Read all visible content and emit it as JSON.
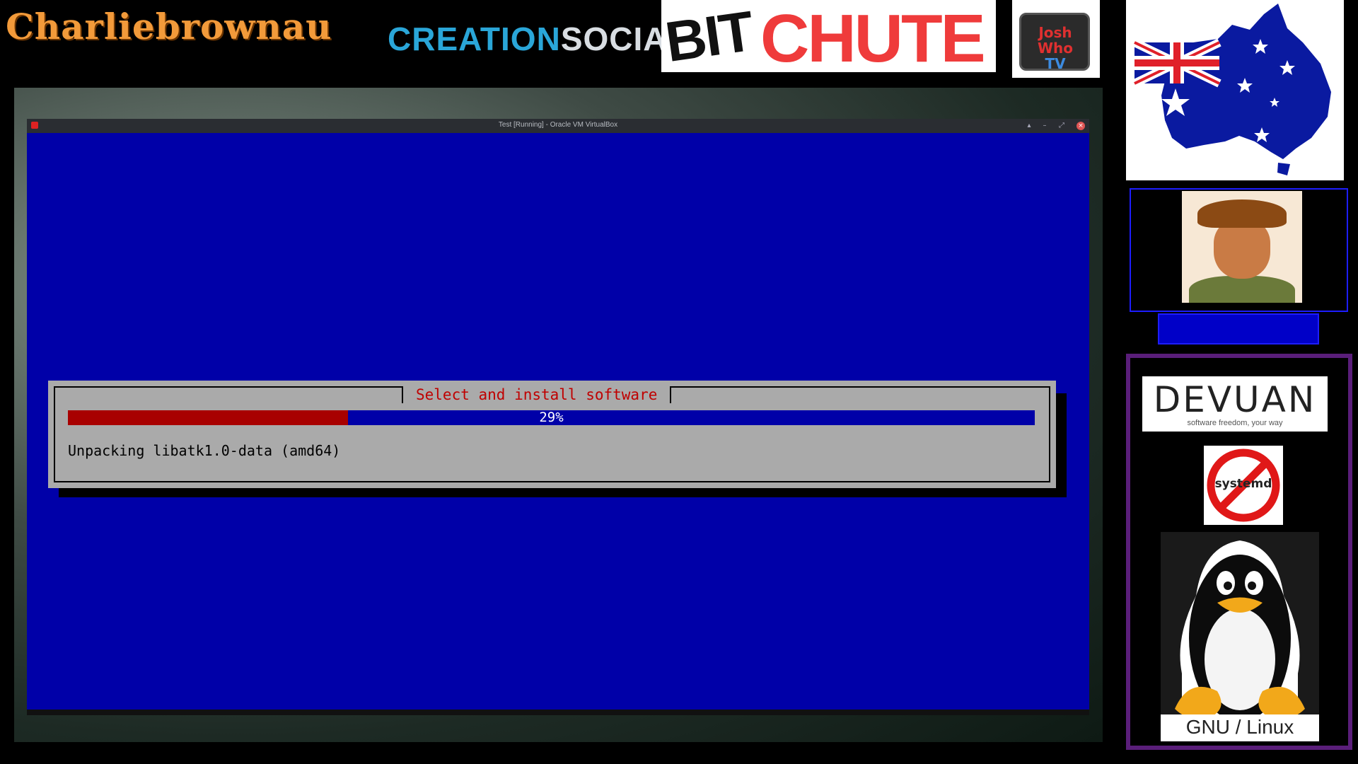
{
  "header": {
    "channel_name": "Charliebrownau",
    "creation_social_part1": "CREATION",
    "creation_social_part2": "SOCIAL",
    "bitchute_part1": "BIT",
    "bitchute_part2": "CHUTE",
    "joshwho_line1": "Josh Who",
    "joshwho_line2": "TV"
  },
  "vm": {
    "window_title": "Test [Running] - Oracle VM VirtualBox",
    "installer": {
      "dialog_title": "Select and install software",
      "progress_percent": 29,
      "progress_label": "29%",
      "status": "Unpacking libatk1.0-data (amd64)"
    }
  },
  "sidebar": {
    "devuan_word": "DEVUAN",
    "devuan_tagline": "software freedom, your way",
    "no_systemd_text": "systemd",
    "tux_caption": "GNU / Linux"
  },
  "colors": {
    "installer_bg": "#0000a8",
    "dialog_bg": "#aaaaaa",
    "progress_fill": "#a80000",
    "dialog_title": "#c00000",
    "channel_name": "#f29a3a",
    "panel_border": "#5a1e7a",
    "webcam_border": "#1d1dff"
  }
}
